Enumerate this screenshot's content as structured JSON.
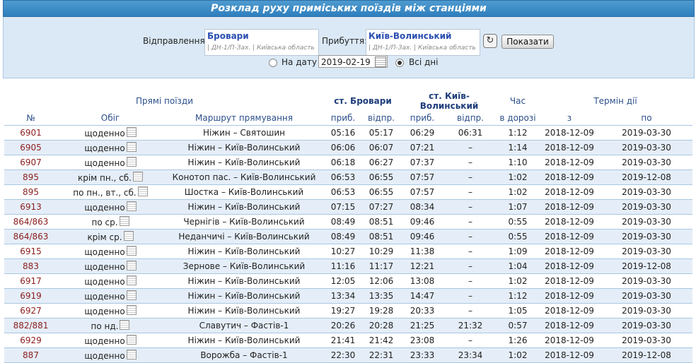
{
  "title": "Розклад руху приміських поїздів між станціями",
  "form": {
    "departure_label": "Відправлення:",
    "departure_station": "Бровари",
    "departure_sub": "| ДН-1/П-Зах. | Київська область",
    "arrival_label": "Прибуття:",
    "arrival_station": "Київ-Волинський",
    "arrival_sub": "| ДН-1/П-Зах. | Київська область",
    "show_button": "Показати",
    "on_date_label": "На дату",
    "date_value": "2019-02-19",
    "all_days_label": "Всі дні",
    "selected": "all_days"
  },
  "table": {
    "group_header": "Прямі поїзди",
    "station_from": "ст. Бровари",
    "station_to": "ст. Київ-Волинський",
    "travel_time_h1": "Час",
    "validity": "Термін дії",
    "col_num": "№",
    "col_schedule": "Обіг",
    "col_route": "Маршрут прямування",
    "col_arr1": "приб.",
    "col_dep1": "відпр.",
    "col_arr2": "приб.",
    "col_dep2": "відпр.",
    "travel_time_h2": "в дорозі",
    "col_from": "з",
    "col_to": "по",
    "rows": [
      {
        "num": "6901",
        "days": "щоденно",
        "route": "Ніжин – Святошин",
        "arr1": "05:16",
        "dep1": "05:17",
        "arr2": "06:29",
        "dep2": "06:31",
        "time": "1:12",
        "from": "2018-12-09",
        "to": "2019-03-30"
      },
      {
        "num": "6905",
        "days": "щоденно",
        "route": "Ніжин – Київ-Волинський",
        "arr1": "06:06",
        "dep1": "06:07",
        "arr2": "07:21",
        "dep2": "–",
        "time": "1:14",
        "from": "2018-12-09",
        "to": "2019-03-30"
      },
      {
        "num": "6907",
        "days": "щоденно",
        "route": "Ніжин – Київ-Волинський",
        "arr1": "06:18",
        "dep1": "06:27",
        "arr2": "07:37",
        "dep2": "–",
        "time": "1:10",
        "from": "2018-12-09",
        "to": "2019-03-30"
      },
      {
        "num": "895",
        "days": "крім пн., сб.",
        "route": "Конотоп пас. – Київ-Волинський",
        "arr1": "06:53",
        "dep1": "06:55",
        "arr2": "07:57",
        "dep2": "–",
        "time": "1:02",
        "from": "2018-12-09",
        "to": "2019-12-08"
      },
      {
        "num": "895",
        "days": "по пн., вт., сб.",
        "route": "Шостка – Київ-Волинський",
        "arr1": "06:53",
        "dep1": "06:55",
        "arr2": "07:57",
        "dep2": "–",
        "time": "1:02",
        "from": "2018-12-09",
        "to": "2019-03-30"
      },
      {
        "num": "6913",
        "days": "щоденно",
        "route": "Ніжин – Київ-Волинський",
        "arr1": "07:15",
        "dep1": "07:27",
        "arr2": "08:34",
        "dep2": "–",
        "time": "1:07",
        "from": "2018-12-09",
        "to": "2019-03-30"
      },
      {
        "num": "864/863",
        "days": "по ср.",
        "route": "Чернігів – Київ-Волинський",
        "arr1": "08:49",
        "dep1": "08:51",
        "arr2": "09:46",
        "dep2": "–",
        "time": "0:55",
        "from": "2018-12-09",
        "to": "2019-03-30"
      },
      {
        "num": "864/863",
        "days": "крім ср.",
        "route": "Неданчичі – Київ-Волинський",
        "arr1": "08:49",
        "dep1": "08:51",
        "arr2": "09:46",
        "dep2": "–",
        "time": "0:55",
        "from": "2018-12-09",
        "to": "2019-03-30"
      },
      {
        "num": "6915",
        "days": "щоденно",
        "route": "Ніжин – Київ-Волинський",
        "arr1": "10:27",
        "dep1": "10:29",
        "arr2": "11:38",
        "dep2": "–",
        "time": "1:09",
        "from": "2018-12-09",
        "to": "2019-03-30"
      },
      {
        "num": "883",
        "days": "щоденно",
        "route": "Зернове – Київ-Волинський",
        "arr1": "11:16",
        "dep1": "11:17",
        "arr2": "12:21",
        "dep2": "–",
        "time": "1:04",
        "from": "2018-12-09",
        "to": "2019-12-08"
      },
      {
        "num": "6917",
        "days": "щоденно",
        "route": "Ніжин – Київ-Волинський",
        "arr1": "12:05",
        "dep1": "12:06",
        "arr2": "13:08",
        "dep2": "–",
        "time": "1:02",
        "from": "2018-12-09",
        "to": "2019-03-30"
      },
      {
        "num": "6919",
        "days": "щоденно",
        "route": "Ніжин – Київ-Волинський",
        "arr1": "13:34",
        "dep1": "13:35",
        "arr2": "14:47",
        "dep2": "–",
        "time": "1:12",
        "from": "2018-12-09",
        "to": "2019-03-30"
      },
      {
        "num": "6927",
        "days": "щоденно",
        "route": "Ніжин – Київ-Волинський",
        "arr1": "19:27",
        "dep1": "19:28",
        "arr2": "20:33",
        "dep2": "–",
        "time": "1:05",
        "from": "2018-12-09",
        "to": "2019-03-30"
      },
      {
        "num": "882/881",
        "days": "по нд.",
        "route": "Славутич – Фастів-1",
        "arr1": "20:26",
        "dep1": "20:28",
        "arr2": "21:25",
        "dep2": "21:32",
        "time": "0:57",
        "from": "2018-12-09",
        "to": "2019-03-30"
      },
      {
        "num": "6929",
        "days": "щоденно",
        "route": "Ніжин – Київ-Волинський",
        "arr1": "21:41",
        "dep1": "21:42",
        "arr2": "23:08",
        "dep2": "–",
        "time": "1:26",
        "from": "2018-12-09",
        "to": "2019-03-30"
      },
      {
        "num": "887",
        "days": "щоденно",
        "route": "Ворожба – Фастів-1",
        "arr1": "22:30",
        "dep1": "22:31",
        "arr2": "23:33",
        "dep2": "23:34",
        "time": "1:02",
        "from": "2018-12-09",
        "to": "2019-12-08"
      }
    ]
  }
}
